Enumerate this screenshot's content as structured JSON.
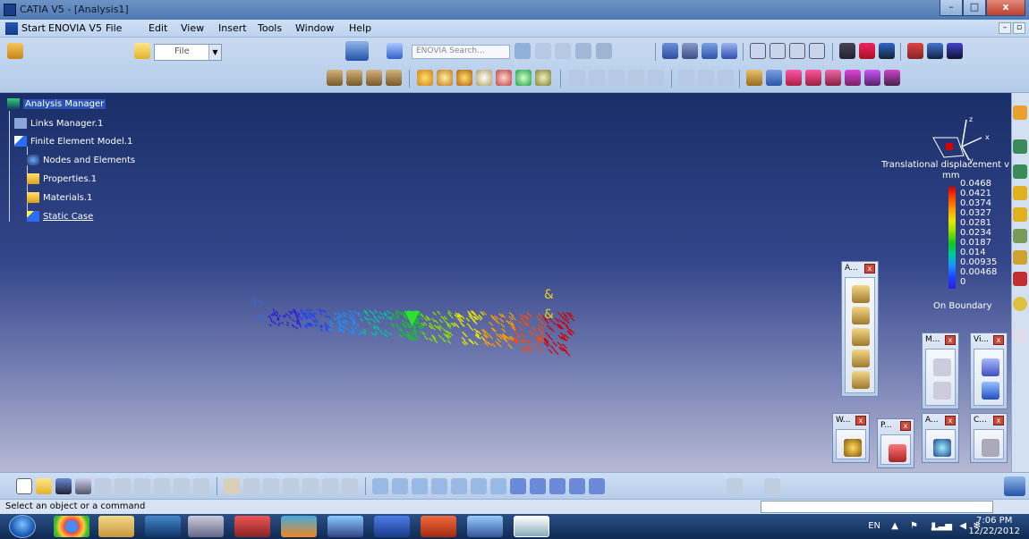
{
  "window": {
    "title": "CATIA V5 - [Analysis1]"
  },
  "menu": {
    "items": [
      "Start",
      "ENOVIA V5",
      "File",
      "Edit",
      "View",
      "Insert",
      "Tools",
      "Window",
      "Help"
    ]
  },
  "toolbar": {
    "combo_value": "File",
    "search_placeholder": "ENOVIA Search..."
  },
  "tree": {
    "root": "Analysis Manager",
    "items": [
      "Links Manager.1",
      "Finite Element Model.1",
      "Nodes and Elements",
      "Properties.1",
      "Materials.1",
      "Static Case"
    ]
  },
  "legend": {
    "title": "Translational displacement v",
    "unit": "mm",
    "values": [
      "0.0468",
      "0.0421",
      "0.0374",
      "0.0327",
      "0.0281",
      "0.0234",
      "0.0187",
      "0.014",
      "0.00935",
      "0.00468",
      "0"
    ],
    "footer": "On Boundary"
  },
  "panels": [
    {
      "title": "A...",
      "icon": "analysis-support-icon"
    },
    {
      "title": "M...",
      "icon": "model-manager-icon"
    },
    {
      "title": "Vi...",
      "icon": "visualization-icon"
    },
    {
      "title": "W...",
      "icon": "workbench-icon"
    },
    {
      "title": "P...",
      "icon": "pdf-report-icon"
    },
    {
      "title": "A...",
      "icon": "analysis-tools-icon"
    },
    {
      "title": "C...",
      "icon": "compute-icon"
    }
  ],
  "status": {
    "text": "Select an object or a command"
  },
  "taskbar": {
    "apps": [
      "chrome",
      "explorer",
      "media-player",
      "catia",
      "solidworks",
      "matlab",
      "games",
      "word",
      "powerpoint",
      "paint",
      "catia-active"
    ],
    "language": "EN",
    "time": "7:06 PM",
    "date": "12/22/2012"
  },
  "colors": {
    "viewport_top": "#1a2e69",
    "viewport_bottom": "#b6bad4",
    "accent": "#4f79b2"
  }
}
